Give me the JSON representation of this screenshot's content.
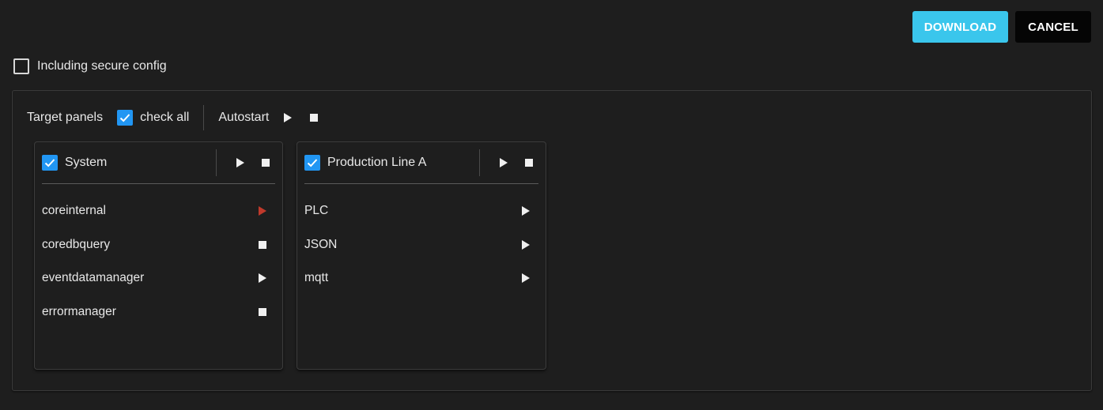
{
  "toolbar": {
    "download_label": "DOWNLOAD",
    "cancel_label": "CANCEL"
  },
  "secure_config": {
    "label": "Including secure config",
    "checked": false
  },
  "targets": {
    "label": "Target panels",
    "check_all_label": "check all",
    "autostart_label": "Autostart"
  },
  "panels": [
    {
      "title": "System",
      "checked": true,
      "items": [
        {
          "name": "coreinternal",
          "state": "play-red"
        },
        {
          "name": "coredbquery",
          "state": "stop"
        },
        {
          "name": "eventdatamanager",
          "state": "play"
        },
        {
          "name": "errormanager",
          "state": "stop"
        }
      ]
    },
    {
      "title": "Production Line A",
      "checked": true,
      "items": [
        {
          "name": "PLC",
          "state": "play"
        },
        {
          "name": "JSON",
          "state": "play"
        },
        {
          "name": "mqtt",
          "state": "play"
        }
      ]
    }
  ],
  "colors": {
    "accent": "#3ac6ec",
    "checkbox": "#2196f3",
    "background": "#1e1e1e",
    "running_red": "#c0392b"
  }
}
